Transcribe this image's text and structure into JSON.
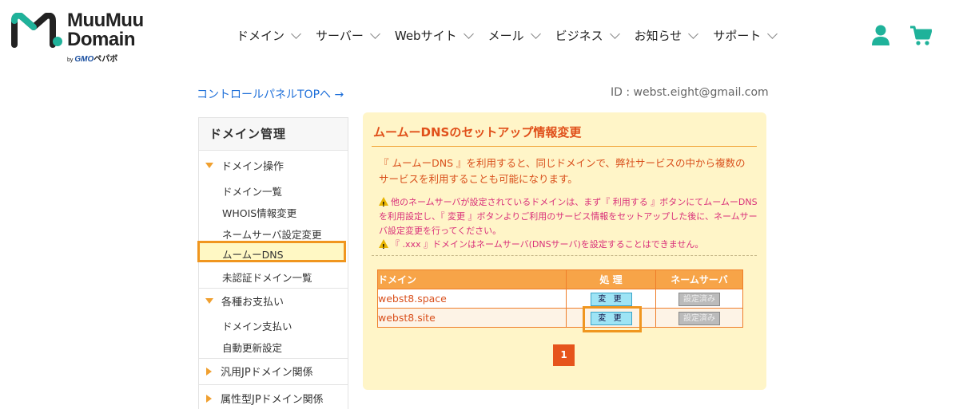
{
  "brand": {
    "line1": "MuuMuu",
    "line2": "Domain",
    "by": "by",
    "gmo": "GMO",
    "sub": "ペパボ",
    "accent_color": "#1fb29a"
  },
  "nav": [
    {
      "label": "ドメイン"
    },
    {
      "label": "サーバー"
    },
    {
      "label": "Webサイト"
    },
    {
      "label": "メール"
    },
    {
      "label": "ビジネス"
    },
    {
      "label": "お知らせ"
    },
    {
      "label": "サポート"
    }
  ],
  "header_icons": {
    "user": "user-icon",
    "cart": "cart-icon"
  },
  "control_panel_link": "コントロールパネルTOPへ →",
  "account_id": "ID : webst.eight@gmail.com",
  "sidebar": {
    "title": "ドメイン管理",
    "group1": {
      "label": "ドメイン操作",
      "items": [
        "ドメイン一覧",
        "WHOIS情報変更",
        "ネームサーバ設定変更",
        "ムームーDNS",
        "未認証ドメイン一覧"
      ]
    },
    "group2": {
      "label": "各種お支払い",
      "items": [
        "ドメイン支払い",
        "自動更新設定"
      ]
    },
    "group3": {
      "label": "汎用JPドメイン関係"
    },
    "group4": {
      "label": "属性型JPドメイン関係"
    }
  },
  "panel": {
    "title": "ムームーDNSのセットアップ情報変更",
    "description": "『 ムームーDNS 』を利用すると、同じドメインで、弊社サービスの中から複数のサービスを利用することも可能になります。",
    "warning1": "他のネームサーバが設定されているドメインは、まず『 利用する 』ボタンにてムームーDNSを利用設定し、『 変更 』ボタンよりご利用のサービス情報をセットアップした後に、ネームサーバ設定変更を行ってください。",
    "warning2": "『 .xxx 』ドメインはネームサーバ(DNSサーバ)を設定することはできません。"
  },
  "table": {
    "headers": [
      "ドメイン",
      "処 理",
      "ネームサーバ"
    ],
    "rows": [
      {
        "domain": "webst8.space",
        "action": "変 更",
        "ns": "設定済み"
      },
      {
        "domain": "webst8.site",
        "action": "変 更",
        "ns": "設定済み"
      }
    ]
  },
  "pagination": {
    "current": "1"
  }
}
